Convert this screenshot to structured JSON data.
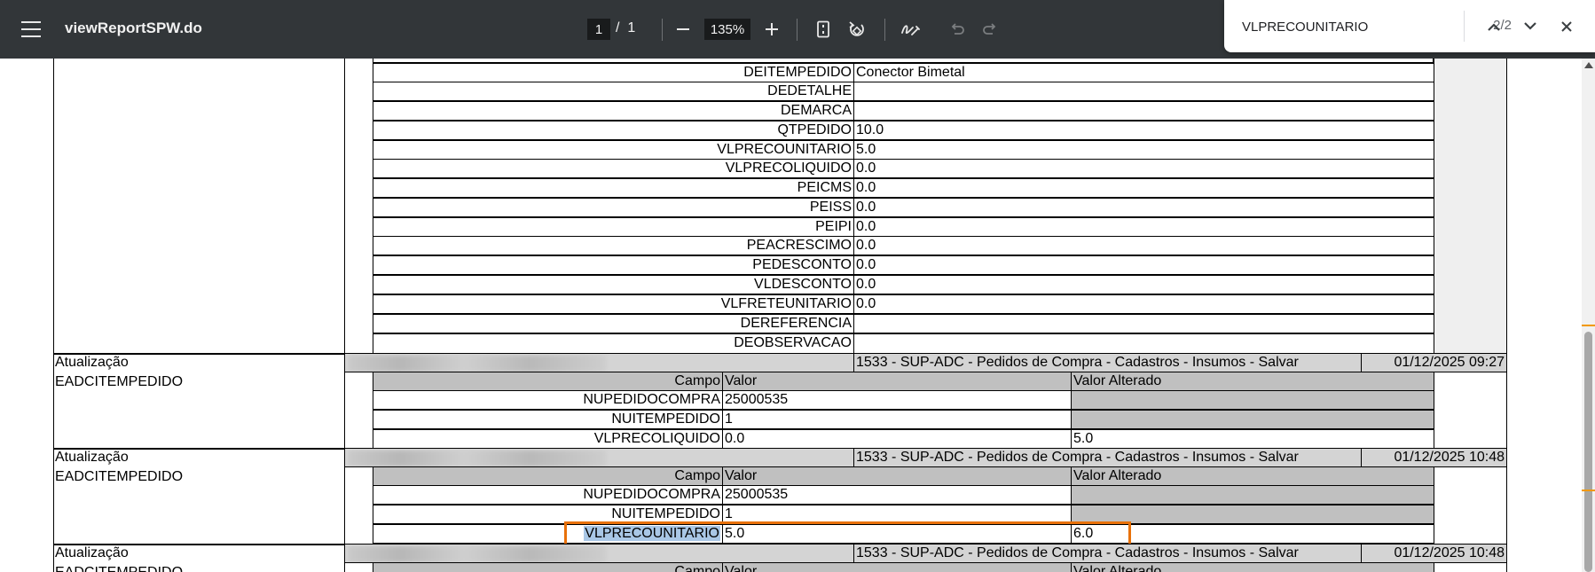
{
  "toolbar": {
    "title": "viewReportSPW.do",
    "page_current": "1",
    "page_sep": "/",
    "page_total": "1",
    "zoom": "135%"
  },
  "find": {
    "query": "VLPRECOUNITARIO",
    "count": "2/2"
  },
  "icons": [
    "menu-icon",
    "zoom-out-icon",
    "zoom-in-icon",
    "fit-page-icon",
    "rotate-icon",
    "draw-icon",
    "undo-icon",
    "redo-icon",
    "find-prev-icon",
    "find-next-icon",
    "find-close-icon"
  ],
  "colors": {
    "toolbar": "#323639",
    "highlight": "#a9c7e6",
    "active_match_border": "#e8710a",
    "header_gray": "#d4d4d4"
  },
  "top_fields": [
    {
      "campo": "DEITEMPEDIDO",
      "valor": "Conector Bimetal"
    },
    {
      "campo": "DEDETALHE",
      "valor": ""
    },
    {
      "campo": "DEMARCA",
      "valor": ""
    },
    {
      "campo": "QTPEDIDO",
      "valor": "10.0"
    },
    {
      "campo": "VLPRECOUNITARIO",
      "valor": "5.0"
    },
    {
      "campo": "VLPRECOLIQUIDO",
      "valor": "0.0"
    },
    {
      "campo": "PEICMS",
      "valor": "0.0"
    },
    {
      "campo": "PEISS",
      "valor": "0.0"
    },
    {
      "campo": "PEIPI",
      "valor": "0.0"
    },
    {
      "campo": "PEACRESCIMO",
      "valor": "0.0"
    },
    {
      "campo": "PEDESCONTO",
      "valor": "0.0"
    },
    {
      "campo": "VLDESCONTO",
      "valor": "0.0"
    },
    {
      "campo": "VLFRETEUNITARIO",
      "valor": "0.0"
    },
    {
      "campo": "DEREFERENCIA",
      "valor": ""
    },
    {
      "campo": "DEOBSERVACAO",
      "valor": ""
    }
  ],
  "headers": {
    "campo": "Campo",
    "valor": "Valor",
    "valor_alterado": "Valor Alterado"
  },
  "entries": [
    {
      "action": "Atualização",
      "table": "EADCITEMPEDIDO",
      "operation": "1533 - SUP-ADC - Pedidos de Compra - Cadastros - Insumos - Salvar",
      "datetime": "01/12/2025 09:27",
      "rows": [
        {
          "campo": "NUPEDIDOCOMPRA",
          "valor": "25000535",
          "alterado": ""
        },
        {
          "campo": "NUITEMPEDIDO",
          "valor": "1",
          "alterado": ""
        },
        {
          "campo": "VLPRECOLIQUIDO",
          "valor": "0.0",
          "alterado": "5.0"
        }
      ]
    },
    {
      "action": "Atualização",
      "table": "EADCITEMPEDIDO",
      "operation": "1533 - SUP-ADC - Pedidos de Compra - Cadastros - Insumos - Salvar",
      "datetime": "01/12/2025 10:48",
      "rows": [
        {
          "campo": "NUPEDIDOCOMPRA",
          "valor": "25000535",
          "alterado": ""
        },
        {
          "campo": "NUITEMPEDIDO",
          "valor": "1",
          "alterado": ""
        },
        {
          "campo": "VLPRECOUNITARIO",
          "valor": "5.0",
          "alterado": "6.0"
        }
      ]
    },
    {
      "action": "Atualização",
      "table": "EADCITEMPEDIDO",
      "operation": "1533 - SUP-ADC - Pedidos de Compra - Cadastros - Insumos - Salvar",
      "datetime": "01/12/2025 10:48",
      "rows": []
    }
  ]
}
